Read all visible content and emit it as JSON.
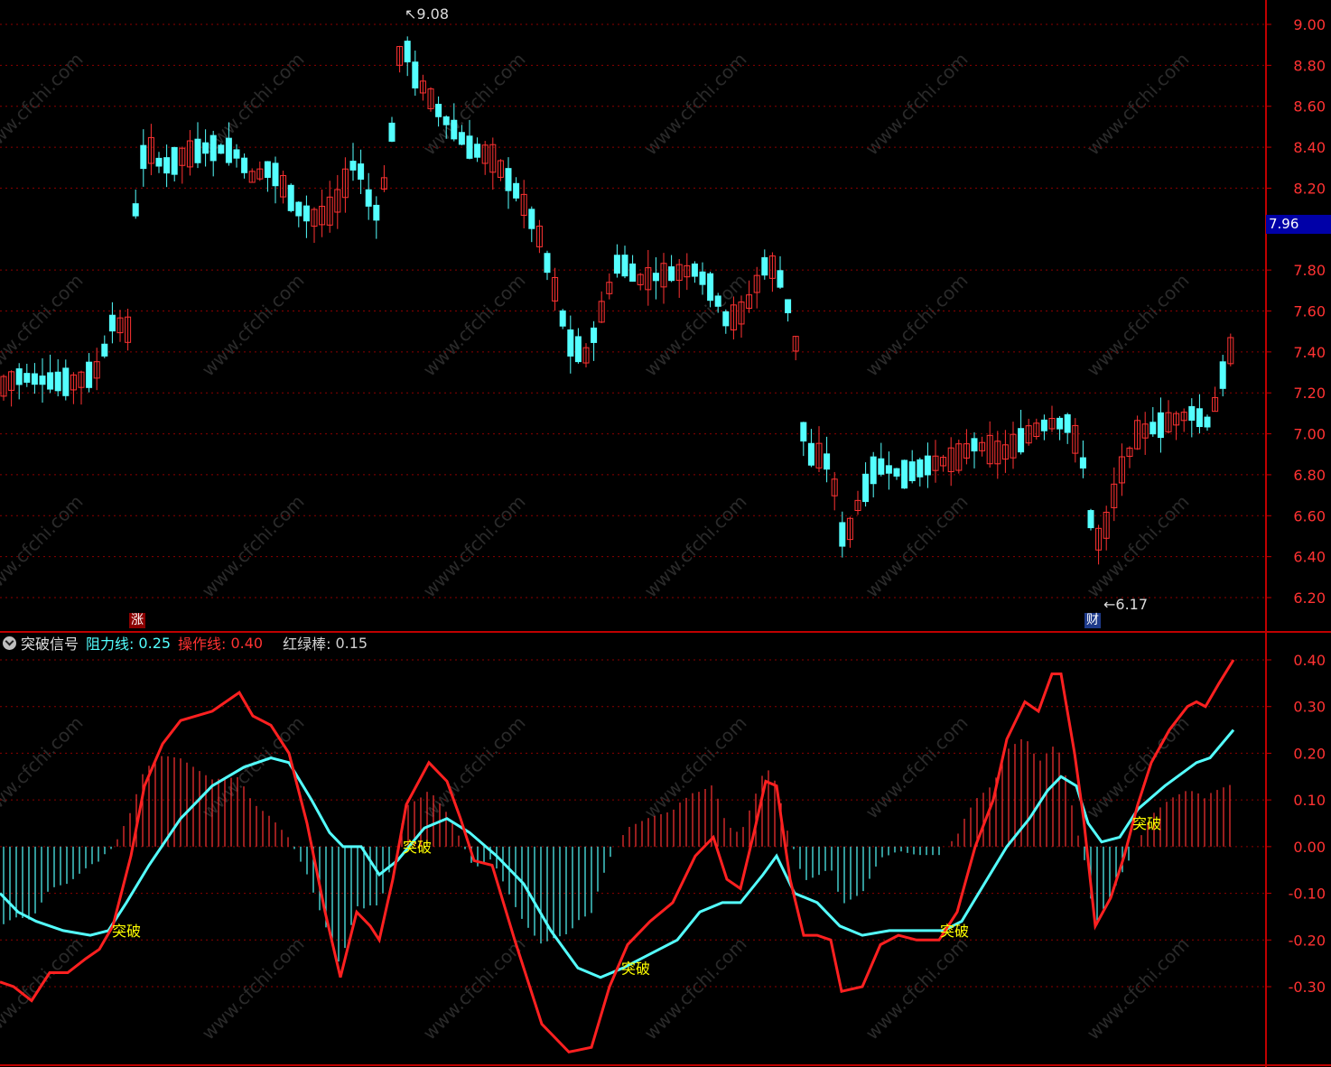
{
  "chart_data": [
    {
      "type": "candlestick",
      "ylim": [
        6.1,
        9.12
      ],
      "yticks": [
        "9.00",
        "8.80",
        "8.60",
        "8.40",
        "8.20",
        "7.80",
        "7.60",
        "7.40",
        "7.20",
        "7.00",
        "6.80",
        "6.60",
        "6.40",
        "6.20"
      ],
      "current_price": "7.96",
      "high_label": "9.08",
      "low_label": "6.17",
      "markers": [
        "涨",
        "财"
      ],
      "colors": {
        "up": "#ff3232",
        "down": "#54ffff",
        "grid": "#8b0000",
        "axis": "#c00000"
      }
    },
    {
      "type": "line",
      "name": "突破信号",
      "legend": [
        {
          "label": "阻力线:",
          "value": "0.25",
          "color": "#54ffff"
        },
        {
          "label": "操作线:",
          "value": "0.40",
          "color": "#ff3232"
        },
        {
          "label": "红绿棒:",
          "value": "0.15",
          "color": "#d0d0d0"
        }
      ],
      "ylim": [
        -0.46,
        0.42
      ],
      "yticks": [
        "0.40",
        "0.30",
        "0.20",
        "0.10",
        "0.00",
        "-0.10",
        "-0.20",
        "-0.30"
      ],
      "signal_label": "突破",
      "signals": 5,
      "colors": {
        "resistance": "#54ffff",
        "operation": "#ff2020",
        "bar_up": "#ff3232",
        "bar_down": "#54ffff",
        "signal": "#ffff00"
      }
    }
  ],
  "watermark": "www.cfchi.com"
}
